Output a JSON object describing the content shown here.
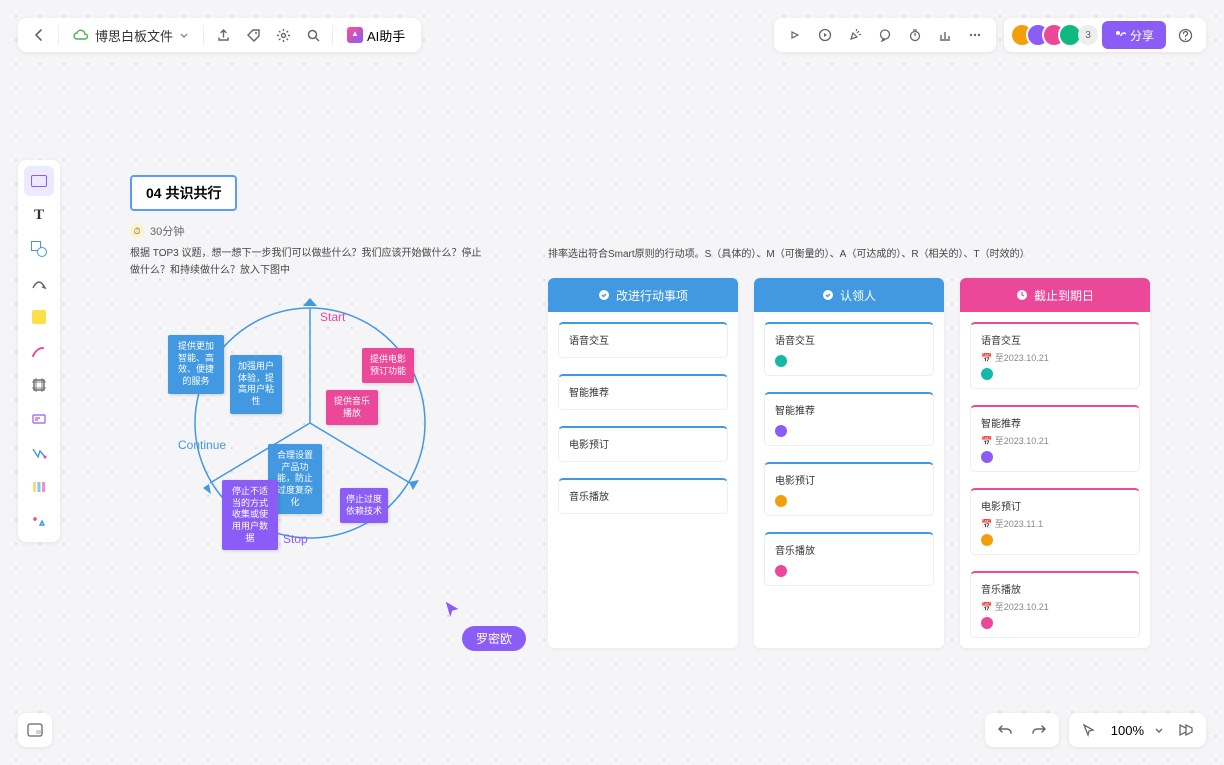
{
  "header": {
    "file_name": "博思白板文件",
    "ai_label": "AI助手"
  },
  "users": {
    "count_extra": "3"
  },
  "share_label": "分享",
  "section": {
    "title": "04 共识共行",
    "time": "30分钟",
    "desc1": "根据 TOP3 议题，想一想下一步我们可以做些什么？我们应该开始做什么？停止做什么？和持续做什么？放入下图中",
    "desc2": "排率选出符合Smart原则的行动项。S（具体的）、M（可衡量的）、A（可达成的）、R（相关的）、T（时效的）"
  },
  "diagram": {
    "labels": {
      "start": "Start",
      "continue": "Continue",
      "stop": "Stop"
    },
    "notes": {
      "n1": "提供更加智能、高效、便捷的服务",
      "n2": "加强用户体验，提高用户粘性",
      "n3": "提供电影预订功能",
      "n4": "提供音乐播放",
      "n5": "合理设置产品功能，防止过度复杂化",
      "n6": "停止不适当的方式收集或使用用户数据",
      "n7": "停止过度依赖技术"
    }
  },
  "columns": [
    {
      "title": "改进行动事项",
      "style": "blue",
      "cards": [
        {
          "title": "语音交互",
          "style": "b-blue"
        },
        {
          "title": "智能推荐",
          "style": "b-blue"
        },
        {
          "title": "电影预订",
          "style": "b-blue"
        },
        {
          "title": "音乐播放",
          "style": "b-blue"
        }
      ]
    },
    {
      "title": "认领人",
      "style": "blue",
      "cards": [
        {
          "title": "语音交互",
          "style": "b-blue",
          "avatar": "mav1"
        },
        {
          "title": "智能推荐",
          "style": "b-blue",
          "avatar": "mav2"
        },
        {
          "title": "电影预订",
          "style": "b-blue",
          "avatar": "mav3"
        },
        {
          "title": "音乐播放",
          "style": "b-blue",
          "avatar": "mav4"
        }
      ]
    },
    {
      "title": "截止到期日",
      "style": "pink",
      "cards": [
        {
          "title": "语音交互",
          "style": "b-pink",
          "date": "至2023.10.21",
          "avatar": "mav1"
        },
        {
          "title": "智能推荐",
          "style": "b-pink",
          "date": "至2023.10.21",
          "avatar": "mav2"
        },
        {
          "title": "电影预订",
          "style": "b-pink",
          "date": "至2023.11.1",
          "avatar": "mav3"
        },
        {
          "title": "音乐播放",
          "style": "b-pink",
          "date": "至2023.10.21",
          "avatar": "mav4"
        }
      ]
    }
  ],
  "cursor_user": "罗密欧",
  "zoom": "100%"
}
